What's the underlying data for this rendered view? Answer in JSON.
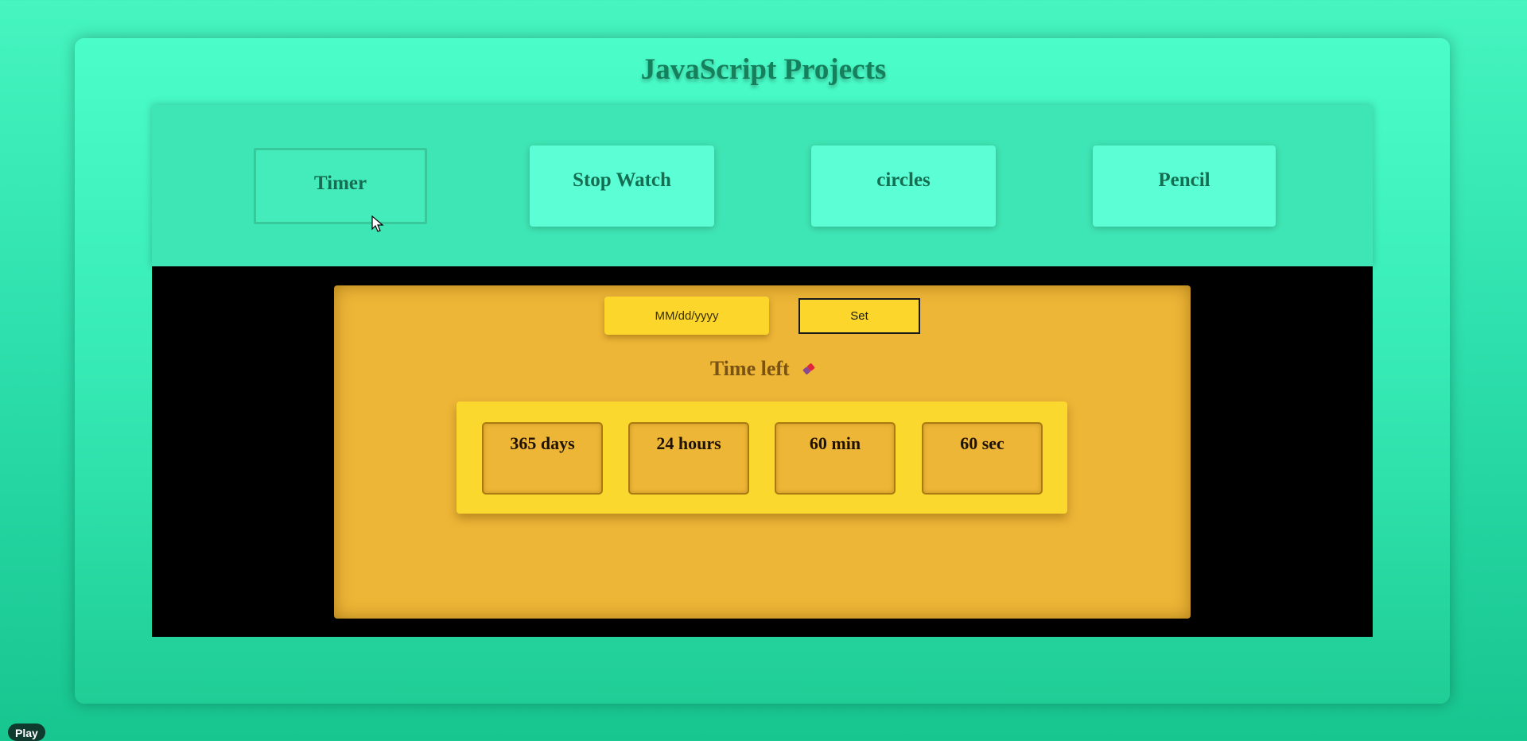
{
  "header": {
    "title": "JavaScript Projects"
  },
  "nav": {
    "active": "Timer",
    "buttons": [
      {
        "label": "Timer",
        "active": true
      },
      {
        "label": "Stop Watch",
        "active": false
      },
      {
        "label": "circles",
        "active": false
      },
      {
        "label": "Pencil",
        "active": false
      }
    ]
  },
  "timer": {
    "date_input": {
      "placeholder": "MM/dd/yyyy",
      "value": ""
    },
    "set_label": "Set",
    "time_left_label": "Time left",
    "time_left_icon": "eraser-icon",
    "countdown": {
      "days": "365 days",
      "hours": "24 hours",
      "minutes": "60 min",
      "seconds": "60 sec"
    }
  },
  "player": {
    "play_label": "Play"
  },
  "colors": {
    "background": "#2ee0ad",
    "title": "#167f5c",
    "nav_button": "#5cfed5",
    "stage": "#000000",
    "timer_card": "#eeb637",
    "countdown_panel": "#fbd82e"
  }
}
